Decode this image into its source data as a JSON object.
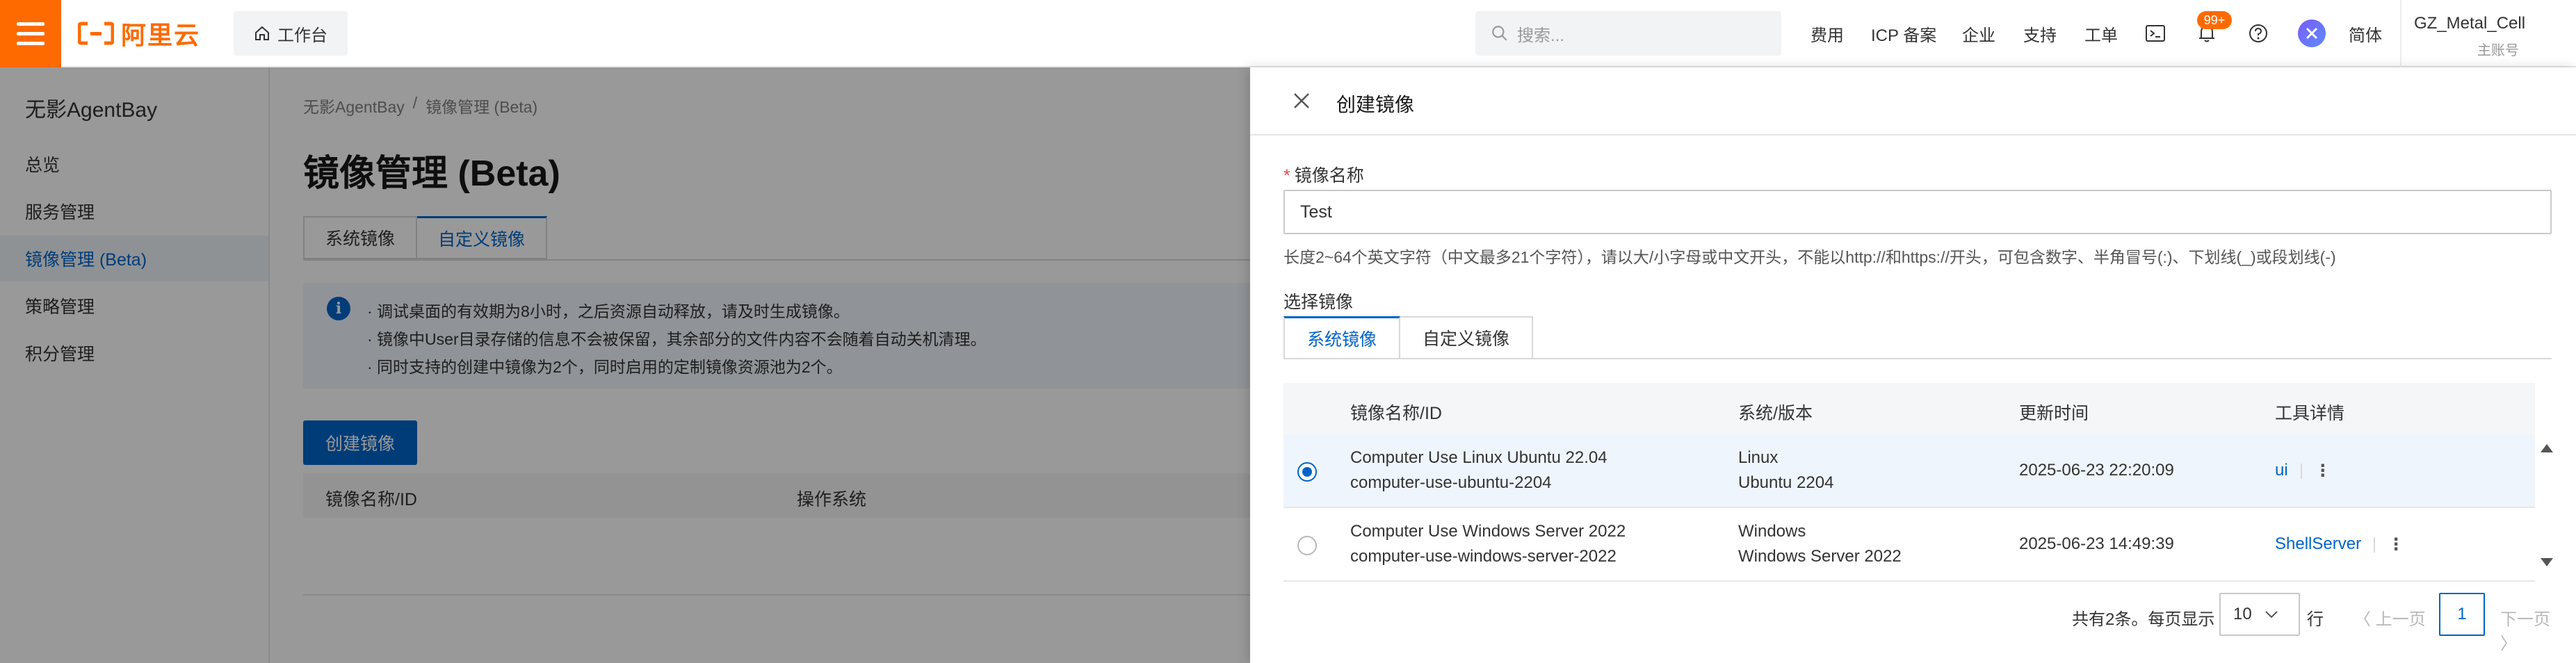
{
  "header": {
    "logo_text": "阿里云",
    "workbench_label": "工作台",
    "search_placeholder": "搜索...",
    "nav": [
      "费用",
      "ICP 备案",
      "企业",
      "支持",
      "工单"
    ],
    "notification_badge": "99+",
    "language": "简体",
    "user_name": "GZ_Metal_Cell",
    "user_role": "主账号",
    "brand_color": "#ff6a00"
  },
  "sidebar": {
    "title": "无影AgentBay",
    "items": [
      {
        "label": "总览",
        "active": false
      },
      {
        "label": "服务管理",
        "active": false
      },
      {
        "label": "镜像管理 (Beta)",
        "active": true
      },
      {
        "label": "策略管理",
        "active": false
      },
      {
        "label": "积分管理",
        "active": false
      }
    ]
  },
  "main": {
    "breadcrumb": [
      "无影AgentBay",
      "/",
      "镜像管理 (Beta)"
    ],
    "title": "镜像管理 (Beta)",
    "tabs": [
      {
        "label": "系统镜像",
        "active": false
      },
      {
        "label": "自定义镜像",
        "active": true
      }
    ],
    "notice": [
      "·  调试桌面的有效期为8小时，之后资源自动释放，请及时生成镜像。",
      "·  镜像中User目录存储的信息不会被保留，其余部分的文件内容不会随着自动关机清理。",
      "·  同时支持的创建中镜像为2个，同时启用的定制镜像资源池为2个。"
    ],
    "create_button": "创建镜像",
    "table_headers": [
      "镜像名称/ID",
      "操作系统"
    ]
  },
  "drawer": {
    "title": "创建镜像",
    "name_label": "镜像名称",
    "name_value": "Test",
    "name_hint": "长度2~64个英文字符（中文最多21个字符），请以大/小字母或中文开头，不能以http://和https://开头，可包含数字、半角冒号(:)、下划线(_)或段划线(-)",
    "select_label": "选择镜像",
    "tabs": [
      {
        "label": "系统镜像",
        "active": true
      },
      {
        "label": "自定义镜像",
        "active": false
      }
    ],
    "table": {
      "headers": [
        "镜像名称/ID",
        "系统/版本",
        "更新时间",
        "工具详情"
      ],
      "rows": [
        {
          "name": "Computer Use Linux Ubuntu 22.04",
          "id": "computer-use-ubuntu-2204",
          "os": "Linux",
          "version": "Ubuntu 2204",
          "updated": "2025-06-23 22:20:09",
          "tool": "ui",
          "selected": true
        },
        {
          "name": "Computer Use Windows Server 2022",
          "id": "computer-use-windows-server-2022",
          "os": "Windows",
          "version": "Windows Server 2022",
          "updated": "2025-06-23 14:49:39",
          "tool": "ShellServer",
          "selected": false
        }
      ]
    },
    "pagination": {
      "total_text": "共有2条。每页显示",
      "page_size": "10",
      "unit": "行",
      "prev": "上一页",
      "current": "1",
      "next": "下一页"
    }
  }
}
